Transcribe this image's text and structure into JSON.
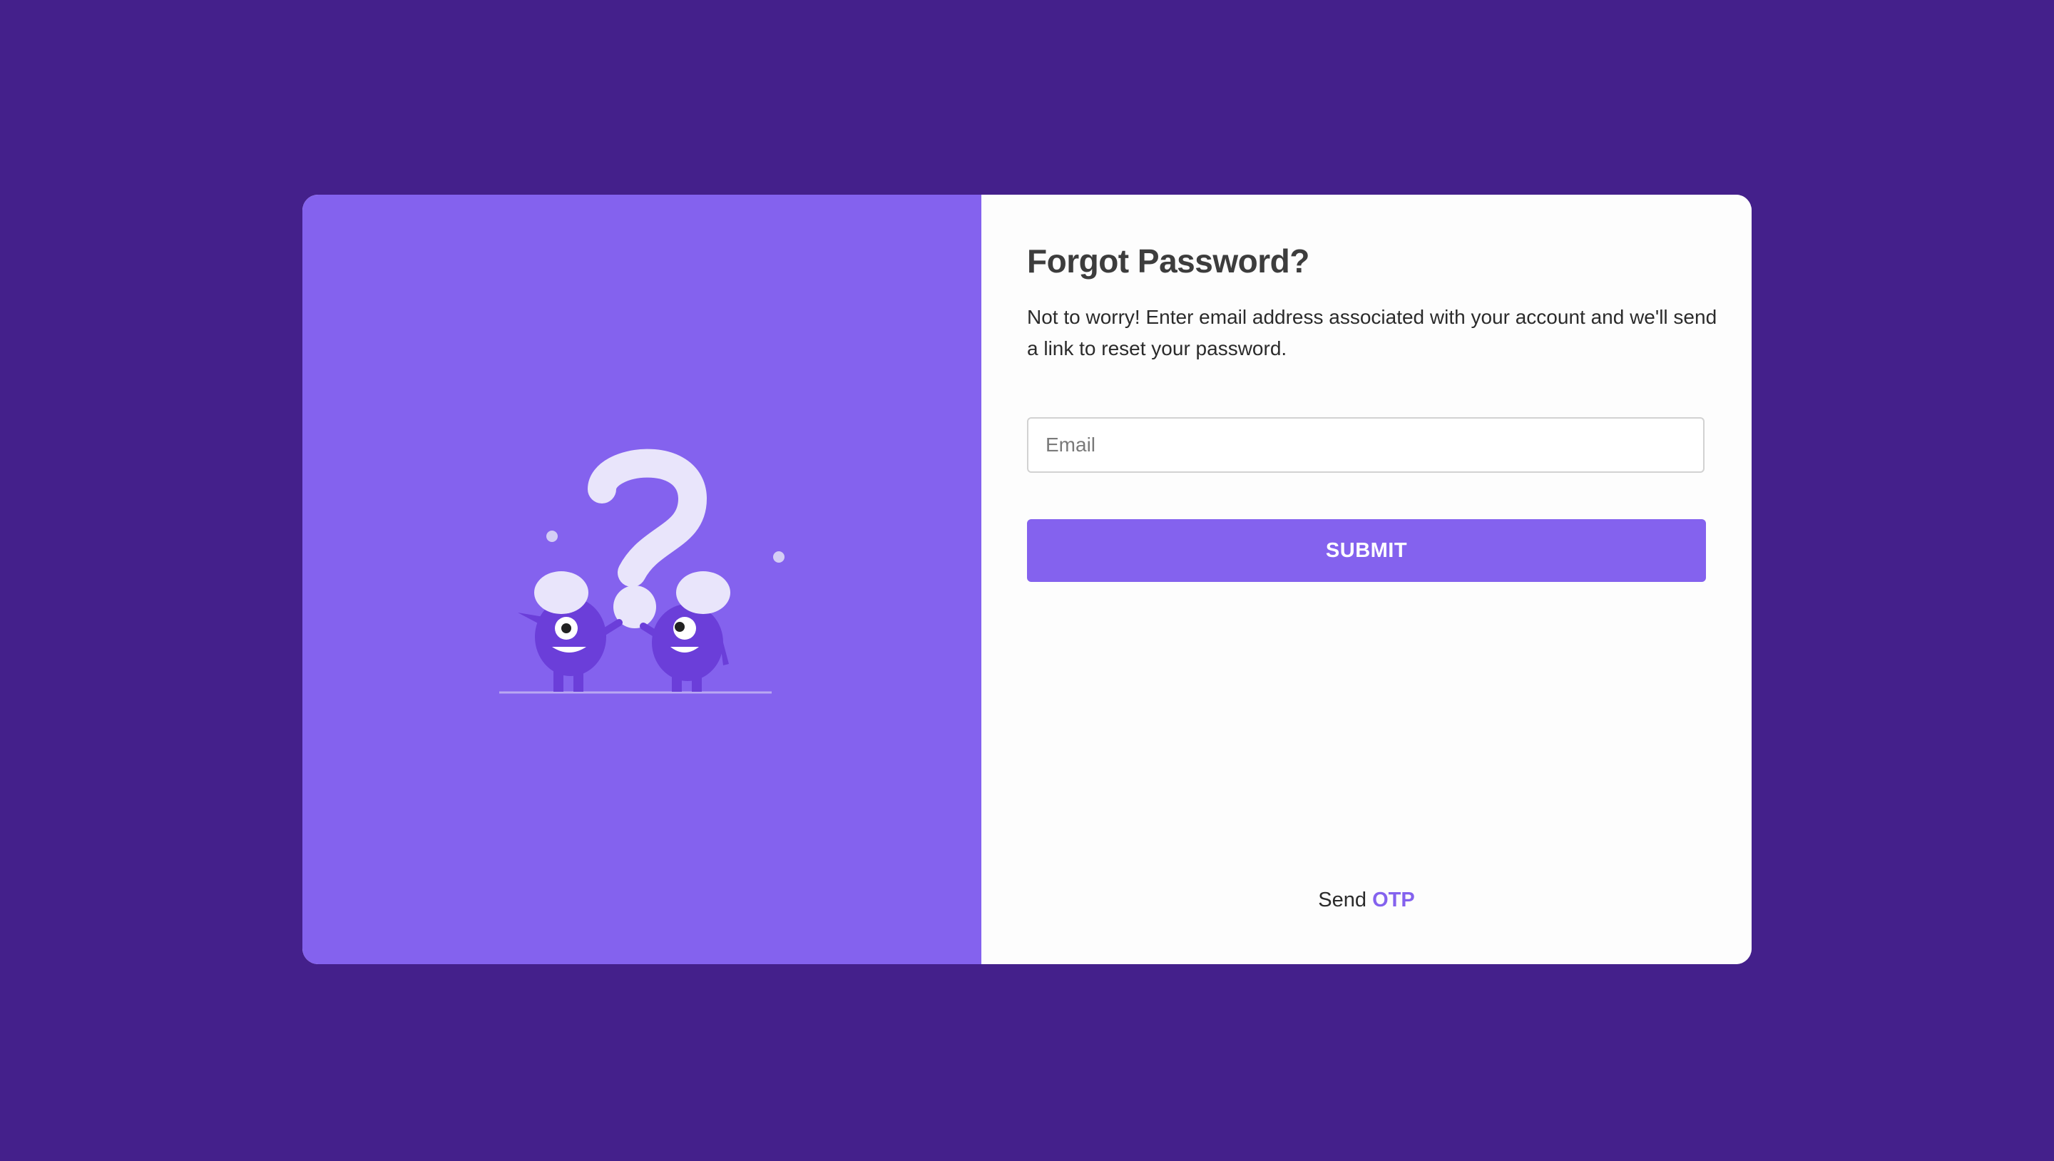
{
  "colors": {
    "background": "#44208b",
    "accent": "#8462ee",
    "card": "#fdfdfd"
  },
  "illustration": {
    "name": "confused-monsters-question-mark"
  },
  "form": {
    "title": "Forgot Password?",
    "description": "Not to worry! Enter email address associated with your account and we'll send a link to reset your password.",
    "email_placeholder": "Email",
    "email_value": "",
    "submit_label": "SUBMIT"
  },
  "footer": {
    "send_text": "Send",
    "otp_link": "OTP"
  }
}
